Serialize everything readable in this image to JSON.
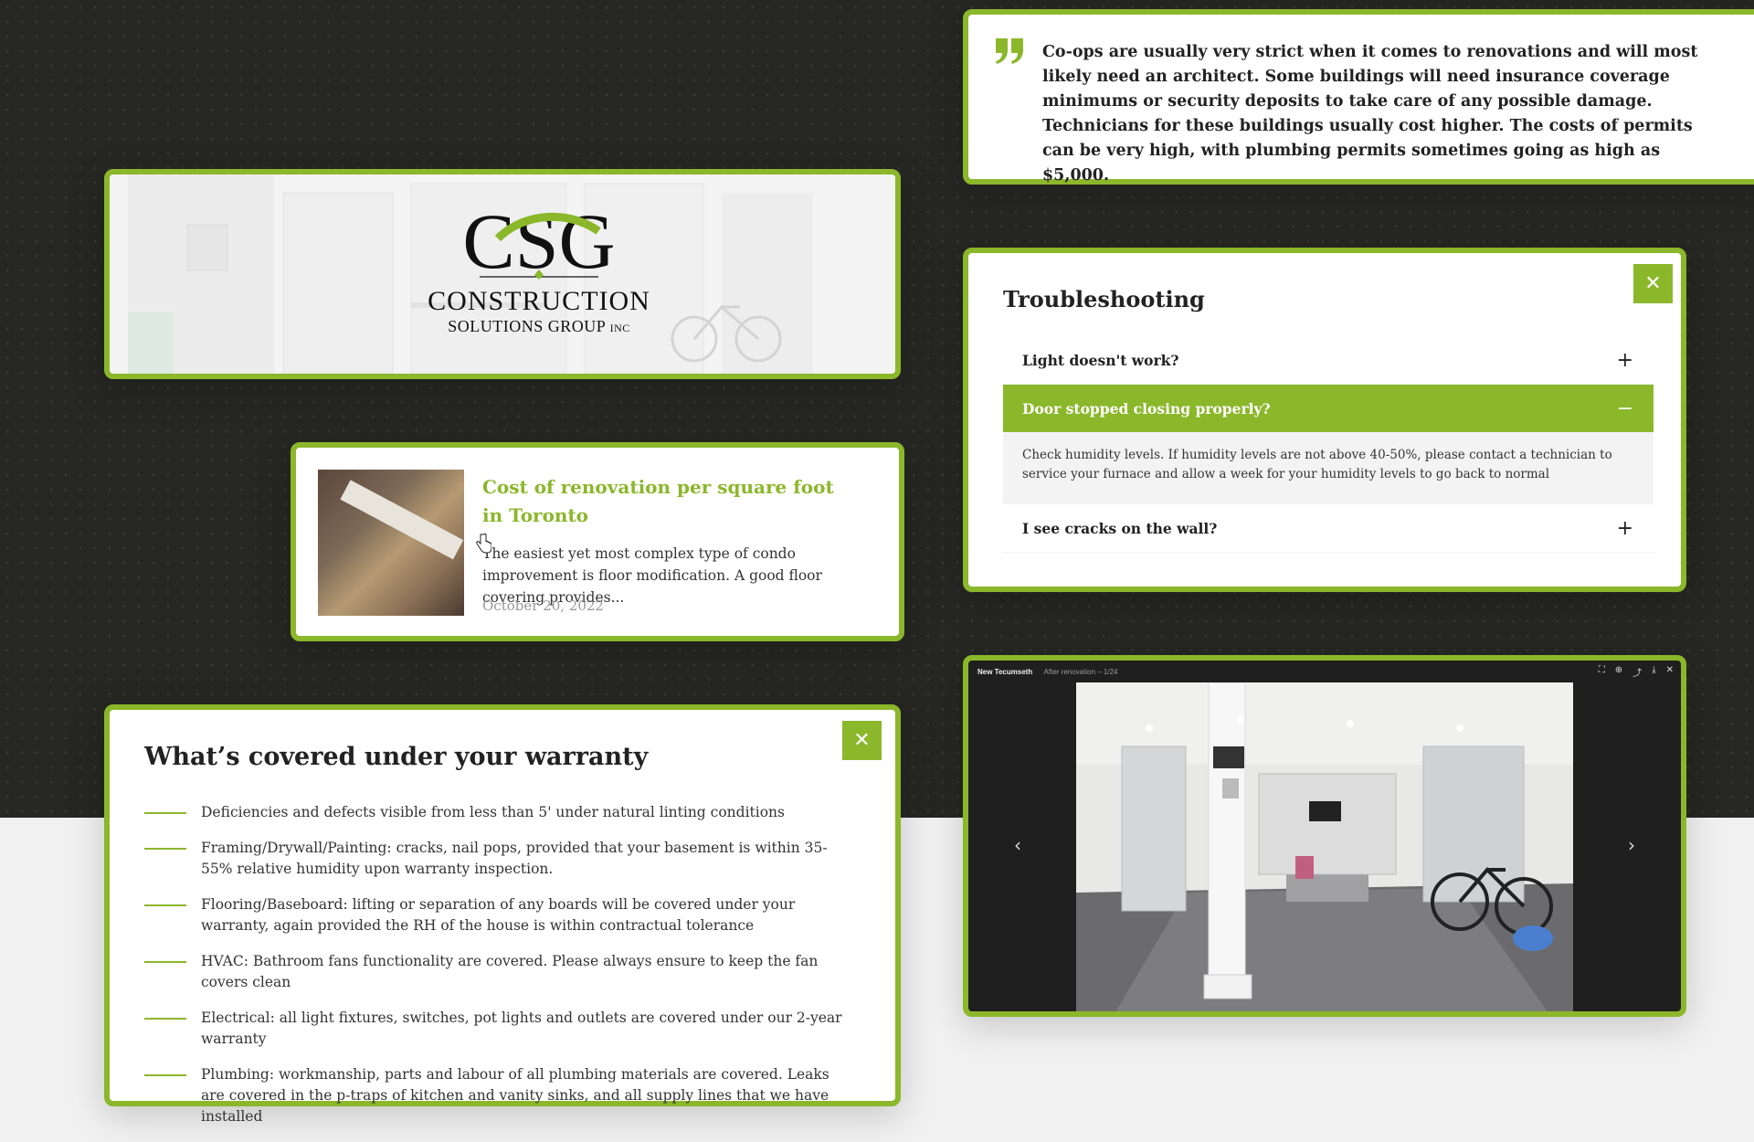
{
  "quote": {
    "text": "Co-ops are usually very strict when it comes to renovations and will most likely need an architect. Some buildings will need insurance coverage minimums or security deposits to take care of any possible damage. Technicians for these buildings usually cost higher. The costs of permits can be very high, with plumbing permits sometimes going as high as $5,000."
  },
  "logo": {
    "monogram": "CSG",
    "line1": "CONSTRUCTION",
    "line2": "SOLUTIONS GROUP",
    "line2_suffix": "INC"
  },
  "article": {
    "title": "Cost of renovation per square foot in Toronto",
    "excerpt": "The easiest yet most complex type of condo improvement is floor modification. A good floor covering provides...",
    "date": "October 20, 2022"
  },
  "troubleshooting": {
    "title": "Troubleshooting",
    "close_label": "✕",
    "items": [
      {
        "question": "Light doesn't work?",
        "sign": "+"
      },
      {
        "question": "Door stopped closing properly?",
        "sign": "−",
        "answer": "Check humidity levels. If humidity levels are not above 40-50%, please contact a technician to service your furnace and allow a week for your humidity levels to go back to normal"
      },
      {
        "question": "I see cracks on the wall?",
        "sign": "+"
      }
    ]
  },
  "gallery": {
    "title": "New Tecumseth",
    "subtitle": "After renovation – 1/24",
    "prev_icon": "chevron-left-icon",
    "next_icon": "chevron-right-icon",
    "prev": "‹",
    "next": "›",
    "tools": [
      "⛶",
      "⊕",
      "⤴",
      "⤓",
      "✕"
    ]
  },
  "warranty": {
    "title": "What’s covered under your warranty",
    "close_label": "✕",
    "items": [
      "Deficiencies and defects visible from less than 5' under natural linting conditions",
      "Framing/Drywall/Painting: cracks, nail pops, provided that your basement is within 35-55% relative humidity upon warranty inspection.",
      "Flooring/Baseboard: lifting or separation of any boards will be covered under your warranty, again provided the RH of the house is within contractual tolerance",
      "HVAC: Bathroom fans functionality are covered. Please always ensure to keep the fan covers clean",
      "Electrical: all light fixtures, switches, pot lights and outlets are covered under our 2-year warranty",
      "Plumbing: workmanship, parts and labour of all plumbing materials are covered. Leaks are covered in the p-traps of kitchen and vanity sinks, and all supply lines that we have installed"
    ]
  },
  "colors": {
    "accent": "#8bb72b",
    "dark_bg": "#262723",
    "light_bg": "#f1f1f1"
  }
}
